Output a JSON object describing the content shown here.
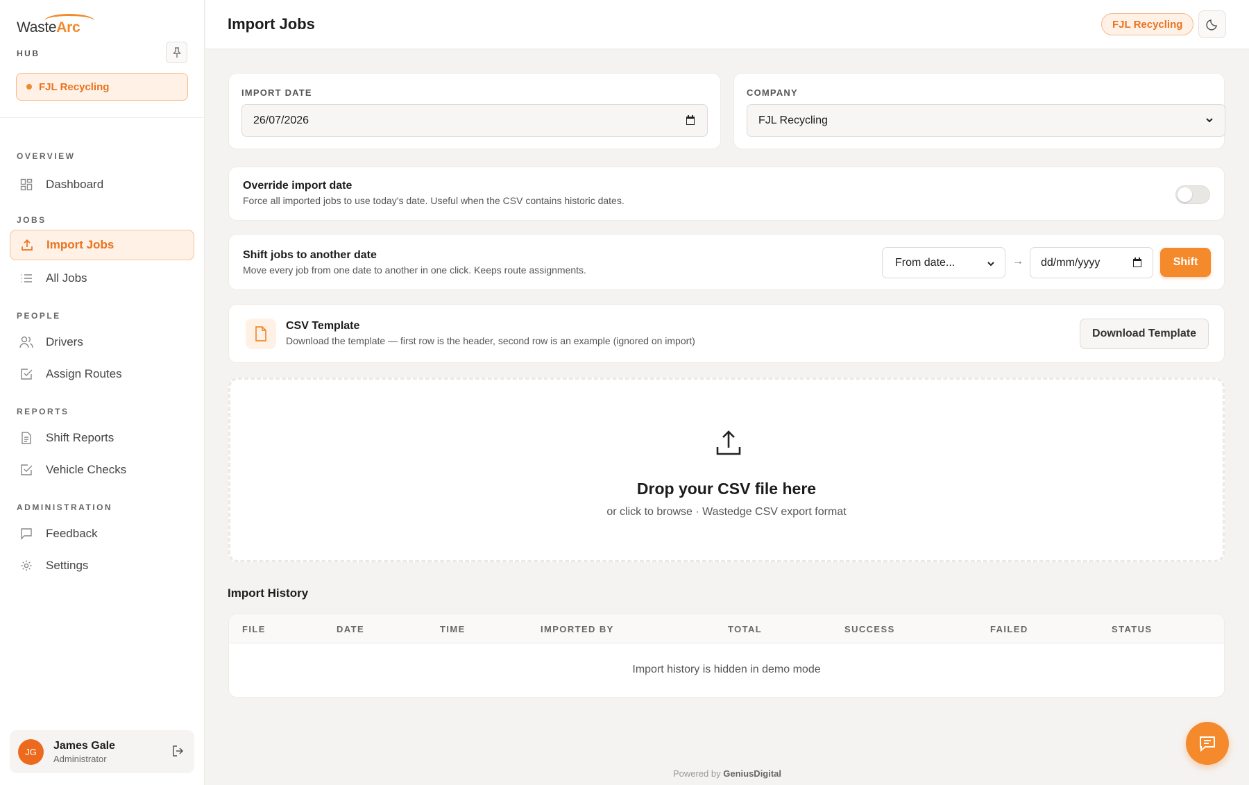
{
  "brand": {
    "logo_left": "Waste",
    "logo_right": "Arc",
    "hub_label": "HUB",
    "company_chip": "FJL Recycling"
  },
  "nav": {
    "sections": [
      {
        "label": "OVERVIEW",
        "items": [
          {
            "label": "Dashboard",
            "icon": "dashboard-icon"
          }
        ]
      },
      {
        "label": "JOBS",
        "items": [
          {
            "label": "Import Jobs",
            "icon": "upload-icon",
            "active": true
          },
          {
            "label": "All Jobs",
            "icon": "list-icon"
          }
        ]
      },
      {
        "label": "PEOPLE",
        "items": [
          {
            "label": "Drivers",
            "icon": "users-icon"
          },
          {
            "label": "Assign Routes",
            "icon": "checkbox-icon"
          }
        ]
      },
      {
        "label": "REPORTS",
        "items": [
          {
            "label": "Shift Reports",
            "icon": "document-icon"
          },
          {
            "label": "Vehicle Checks",
            "icon": "checkbox-icon"
          }
        ]
      },
      {
        "label": "ADMINISTRATION",
        "items": [
          {
            "label": "Feedback",
            "icon": "message-icon"
          },
          {
            "label": "Settings",
            "icon": "gear-icon"
          }
        ]
      }
    ]
  },
  "user": {
    "initials": "JG",
    "name": "James Gale",
    "role": "Administrator"
  },
  "header": {
    "title": "Import Jobs",
    "company_chip": "FJL Recycling"
  },
  "import_date": {
    "label": "IMPORT DATE",
    "value": "26/07/2026"
  },
  "company": {
    "label": "COMPANY",
    "value": "FJL Recycling"
  },
  "override": {
    "title": "Override import date",
    "description": "Force all imported jobs to use today's date. Useful when the CSV contains historic dates.",
    "enabled": false
  },
  "shift": {
    "title": "Shift jobs to another date",
    "description": "Move every job from one date to another in one click. Keeps route assignments.",
    "from_placeholder": "From date...",
    "arrow": "→",
    "to_placeholder": "dd/mm/yyyy",
    "button": "Shift"
  },
  "csv_template": {
    "title": "CSV Template",
    "description": "Download the template — first row is the header, second row is an example (ignored on import)",
    "button": "Download Template"
  },
  "dropzone": {
    "title": "Drop your CSV file here",
    "subtitle": "or click to browse · Wastedge CSV export format"
  },
  "history": {
    "title": "Import History",
    "columns": [
      "FILE",
      "DATE",
      "TIME",
      "IMPORTED BY",
      "TOTAL",
      "SUCCESS",
      "FAILED",
      "STATUS"
    ],
    "empty_message": "Import history is hidden in demo mode"
  },
  "footer": {
    "powered_prefix": "Powered by",
    "powered_brand": "GeniusDigital"
  },
  "colors": {
    "accent": "#f48a2c",
    "accent_text": "#e8731f",
    "accent_bg": "#fff1e6"
  }
}
